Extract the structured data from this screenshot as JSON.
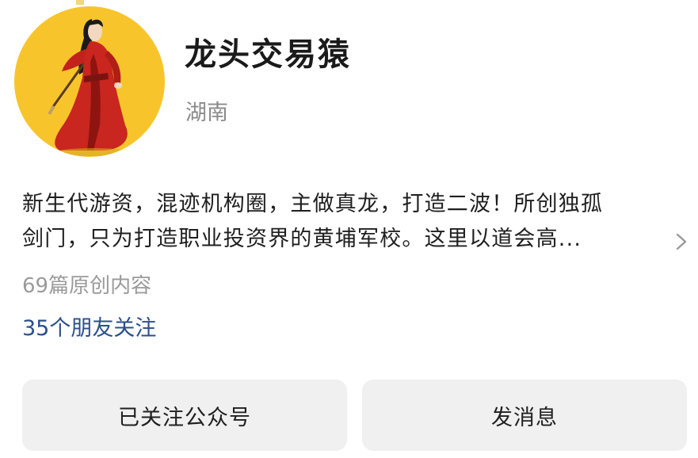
{
  "profile": {
    "name": "龙头交易猿",
    "region": "湖南"
  },
  "description": {
    "line1": "新生代游资，混迹机构圈，主做真龙，打造二波！所创独孤",
    "line2": "剑门，只为打造职业投资界的黄埔军校。这里以道会高..."
  },
  "stats": {
    "articles": "69篇原创内容",
    "friends": "35个朋友关注"
  },
  "buttons": {
    "followed": "已关注公众号",
    "message": "发消息"
  },
  "icons": {
    "avatar": "red-robed-swordsman-avatar",
    "expand": "chevron-right-icon"
  },
  "colors": {
    "avatar_bg": "#f7c52b",
    "link": "#2a4f8c",
    "muted": "#8a8a8a",
    "button_bg": "#f0f0f0"
  }
}
